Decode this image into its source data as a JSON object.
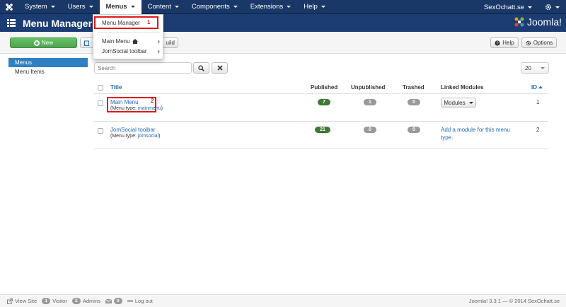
{
  "topbar": {
    "menus": [
      {
        "label": "System",
        "active": false
      },
      {
        "label": "Users",
        "active": false
      },
      {
        "label": "Menus",
        "active": true
      },
      {
        "label": "Content",
        "active": false
      },
      {
        "label": "Components",
        "active": false
      },
      {
        "label": "Extensions",
        "active": false
      },
      {
        "label": "Help",
        "active": false
      }
    ],
    "site_name": "SexOchatt.se"
  },
  "titlebar": {
    "title": "Menu Manager: ",
    "brand": "Joomla!"
  },
  "toolbar": {
    "new_label": "New",
    "rebuild_label": "uild",
    "help_label": "Help",
    "options_label": "Options"
  },
  "menus_dropdown": {
    "items": [
      {
        "label": "Menu Manager"
      },
      {
        "label": "Main Menu"
      },
      {
        "label": "JomSocial toolbar"
      }
    ]
  },
  "annotations": {
    "one": "1",
    "two": "2"
  },
  "sidebar": {
    "items": [
      {
        "label": "Menus",
        "active": true
      },
      {
        "label": "Menu Items",
        "active": false
      }
    ]
  },
  "filters": {
    "search_placeholder": "Search",
    "limit": "20"
  },
  "table": {
    "headers": {
      "title": "Title",
      "published": "Published",
      "unpublished": "Unpublished",
      "trashed": "Trashed",
      "linked_modules": "Linked Modules",
      "id": "ID"
    },
    "rows": [
      {
        "title": "Main Menu",
        "menu_type_prefix": "(Menu type: ",
        "menu_type": "mainmenu",
        "menu_type_suffix": ")",
        "published": "7",
        "unpublished": "1",
        "trashed": "0",
        "modules_label": "Modules",
        "id": "1"
      },
      {
        "title": "JomSocial toolbar",
        "menu_type_prefix": "(Menu type: ",
        "menu_type": "jomsocial",
        "menu_type_suffix": ")",
        "published": "21",
        "unpublished": "0",
        "trashed": "0",
        "add_module_line1": "Add a module for this menu",
        "add_module_line2": "type.",
        "id": "2"
      }
    ]
  },
  "statusbar": {
    "view_site": "View Site",
    "visitors_count": "1",
    "visitors_label": "Visitor",
    "admins_count": "2",
    "admins_label": "Admins",
    "messages_count": "0",
    "logout": "Log out",
    "version": "Joomla! 3.3.1",
    "copyright": "— © 2014 SexOchatt.se"
  },
  "colors": {
    "topbar": "#1a3867",
    "accent": "#2f80c2",
    "annotation": "#e0181b",
    "published_badge": "#3f7736"
  }
}
